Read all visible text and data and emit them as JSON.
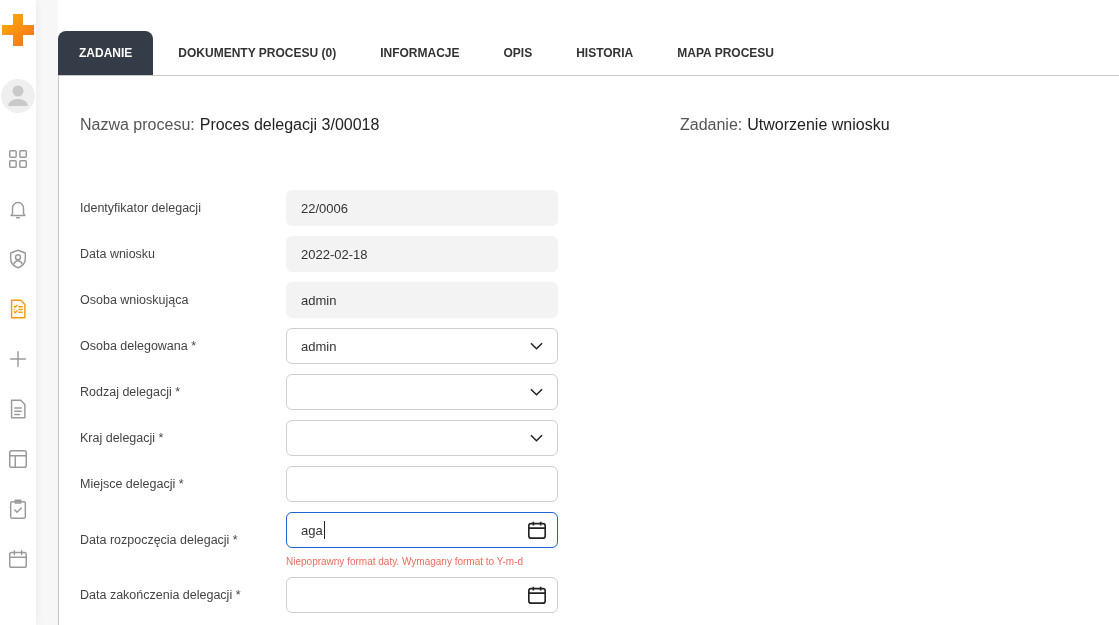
{
  "sidebar": {
    "items": [
      {
        "selected": false
      },
      {
        "selected": false
      },
      {
        "selected": false
      },
      {
        "selected": true
      },
      {
        "selected": false
      },
      {
        "selected": false
      },
      {
        "selected": false
      },
      {
        "selected": false
      },
      {
        "selected": false
      }
    ]
  },
  "tabs": [
    {
      "label": "ZADANIE",
      "selected": true
    },
    {
      "label": "DOKUMENTY PROCESU (0)",
      "selected": false
    },
    {
      "label": "INFORMACJE",
      "selected": false
    },
    {
      "label": "OPIS",
      "selected": false
    },
    {
      "label": "HISTORIA",
      "selected": false
    },
    {
      "label": "MAPA PROCESU",
      "selected": false
    }
  ],
  "header": {
    "process_label": "Nazwa procesu:",
    "process_value": "Proces delegacji 3/00018",
    "task_label": "Zadanie:",
    "task_value": "Utworzenie wniosku"
  },
  "form": {
    "fields": [
      {
        "kind": "readonly",
        "label": "Identyfikator delegacji",
        "value": "22/0006"
      },
      {
        "kind": "readonly",
        "label": "Data wniosku",
        "value": "2022-02-18"
      },
      {
        "kind": "readonly",
        "label": "Osoba wnioskująca",
        "value": "admin"
      },
      {
        "kind": "select",
        "label": "Osoba delegowana *",
        "value": "admin"
      },
      {
        "kind": "select",
        "label": "Rodzaj delegacji *"
      },
      {
        "kind": "select",
        "label": "Kraj delegacji *"
      },
      {
        "kind": "text",
        "label": "Miejsce delegacji *"
      },
      {
        "kind": "date",
        "label": "Data rozpoczęcia delegacji *",
        "value": "aga",
        "focused": true,
        "error": "Niepoprawny format daty. Wymagany format to Y-m-d"
      },
      {
        "kind": "date",
        "label": "Data zakończenia delegacji *",
        "focused": false
      }
    ]
  }
}
